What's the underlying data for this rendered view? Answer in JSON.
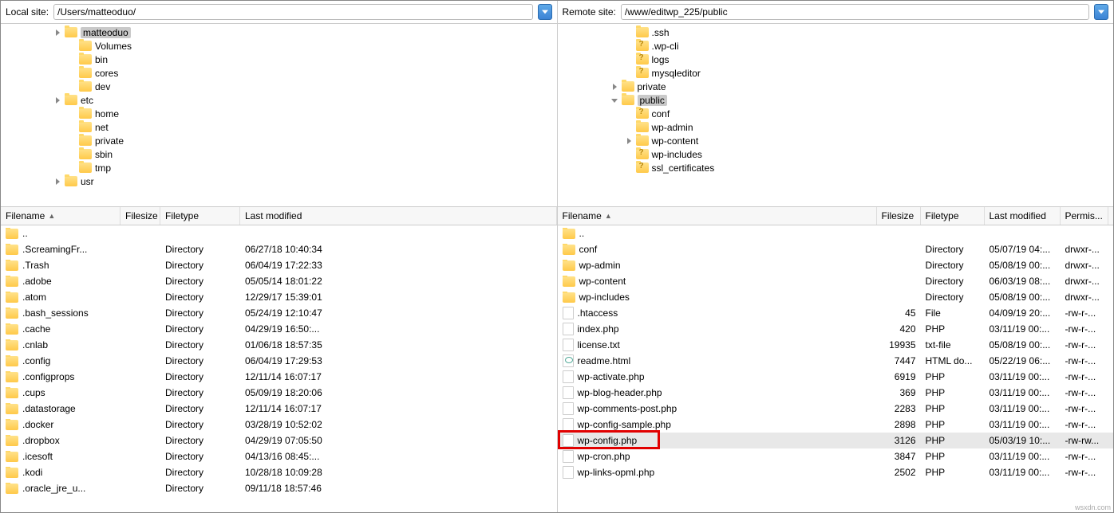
{
  "local": {
    "label": "Local site:",
    "path": "/Users/matteoduo/",
    "tree": [
      {
        "depth": 2,
        "exp": "right",
        "icon": "folder",
        "name": "matteoduo",
        "selected": true
      },
      {
        "depth": 3,
        "exp": "",
        "icon": "folder",
        "name": "Volumes"
      },
      {
        "depth": 3,
        "exp": "",
        "icon": "folder",
        "name": "bin"
      },
      {
        "depth": 3,
        "exp": "",
        "icon": "folder",
        "name": "cores"
      },
      {
        "depth": 3,
        "exp": "",
        "icon": "folder",
        "name": "dev"
      },
      {
        "depth": 2,
        "exp": "right",
        "icon": "folder",
        "name": "etc"
      },
      {
        "depth": 3,
        "exp": "",
        "icon": "folder",
        "name": "home"
      },
      {
        "depth": 3,
        "exp": "",
        "icon": "folder",
        "name": "net"
      },
      {
        "depth": 3,
        "exp": "",
        "icon": "folder",
        "name": "private"
      },
      {
        "depth": 3,
        "exp": "",
        "icon": "folder",
        "name": "sbin"
      },
      {
        "depth": 3,
        "exp": "",
        "icon": "folder",
        "name": "tmp"
      },
      {
        "depth": 2,
        "exp": "right",
        "icon": "folder",
        "name": "usr"
      }
    ],
    "cols": [
      "Filename",
      "Filesize",
      "Filetype",
      "Last modified"
    ],
    "files": [
      {
        "icon": "folder",
        "name": "..",
        "size": "",
        "type": "",
        "mod": ""
      },
      {
        "icon": "folder",
        "name": ".ScreamingFr...",
        "size": "",
        "type": "Directory",
        "mod": "06/27/18 10:40:34"
      },
      {
        "icon": "folder",
        "name": ".Trash",
        "size": "",
        "type": "Directory",
        "mod": "06/04/19 17:22:33"
      },
      {
        "icon": "folder",
        "name": ".adobe",
        "size": "",
        "type": "Directory",
        "mod": "05/05/14 18:01:22"
      },
      {
        "icon": "folder",
        "name": ".atom",
        "size": "",
        "type": "Directory",
        "mod": "12/29/17 15:39:01"
      },
      {
        "icon": "folder",
        "name": ".bash_sessions",
        "size": "",
        "type": "Directory",
        "mod": "05/24/19 12:10:47"
      },
      {
        "icon": "folder",
        "name": ".cache",
        "size": "",
        "type": "Directory",
        "mod": "04/29/19 16:50:..."
      },
      {
        "icon": "folder",
        "name": ".cnlab",
        "size": "",
        "type": "Directory",
        "mod": "01/06/18 18:57:35"
      },
      {
        "icon": "folder",
        "name": ".config",
        "size": "",
        "type": "Directory",
        "mod": "06/04/19 17:29:53"
      },
      {
        "icon": "folder",
        "name": ".configprops",
        "size": "",
        "type": "Directory",
        "mod": "12/11/14 16:07:17"
      },
      {
        "icon": "folder",
        "name": ".cups",
        "size": "",
        "type": "Directory",
        "mod": "05/09/19 18:20:06"
      },
      {
        "icon": "folder",
        "name": ".datastorage",
        "size": "",
        "type": "Directory",
        "mod": "12/11/14 16:07:17"
      },
      {
        "icon": "folder",
        "name": ".docker",
        "size": "",
        "type": "Directory",
        "mod": "03/28/19 10:52:02"
      },
      {
        "icon": "folder",
        "name": ".dropbox",
        "size": "",
        "type": "Directory",
        "mod": "04/29/19 07:05:50"
      },
      {
        "icon": "folder",
        "name": ".icesoft",
        "size": "",
        "type": "Directory",
        "mod": "04/13/16 08:45:..."
      },
      {
        "icon": "folder",
        "name": ".kodi",
        "size": "",
        "type": "Directory",
        "mod": "10/28/18 10:09:28"
      },
      {
        "icon": "folder",
        "name": ".oracle_jre_u...",
        "size": "",
        "type": "Directory",
        "mod": "09/11/18 18:57:46"
      }
    ]
  },
  "remote": {
    "label": "Remote site:",
    "path": "/www/editwp_225/public",
    "tree": [
      {
        "depth": 3,
        "exp": "",
        "icon": "folder",
        "name": ".ssh"
      },
      {
        "depth": 3,
        "exp": "",
        "icon": "question",
        "name": ".wp-cli"
      },
      {
        "depth": 3,
        "exp": "",
        "icon": "question",
        "name": "logs"
      },
      {
        "depth": 3,
        "exp": "",
        "icon": "question",
        "name": "mysqleditor"
      },
      {
        "depth": 2,
        "exp": "right",
        "icon": "folder",
        "name": "private"
      },
      {
        "depth": 2,
        "exp": "down",
        "icon": "folder",
        "name": "public",
        "selected": true
      },
      {
        "depth": 3,
        "exp": "",
        "icon": "question",
        "name": "conf"
      },
      {
        "depth": 3,
        "exp": "",
        "icon": "folder",
        "name": "wp-admin"
      },
      {
        "depth": 2,
        "exp": "right",
        "icon": "folder",
        "name": "wp-content",
        "extraIndent": 1
      },
      {
        "depth": 3,
        "exp": "",
        "icon": "question",
        "name": "wp-includes"
      },
      {
        "depth": 3,
        "exp": "",
        "icon": "question",
        "name": "ssl_certificates"
      }
    ],
    "cols": [
      "Filename",
      "Filesize",
      "Filetype",
      "Last modified",
      "Permis..."
    ],
    "files": [
      {
        "icon": "folder",
        "name": "..",
        "size": "",
        "type": "",
        "mod": "",
        "perm": ""
      },
      {
        "icon": "folder",
        "name": "conf",
        "size": "",
        "type": "Directory",
        "mod": "05/07/19 04:...",
        "perm": "drwxr-..."
      },
      {
        "icon": "folder",
        "name": "wp-admin",
        "size": "",
        "type": "Directory",
        "mod": "05/08/19 00:...",
        "perm": "drwxr-..."
      },
      {
        "icon": "folder",
        "name": "wp-content",
        "size": "",
        "type": "Directory",
        "mod": "06/03/19 08:...",
        "perm": "drwxr-..."
      },
      {
        "icon": "folder",
        "name": "wp-includes",
        "size": "",
        "type": "Directory",
        "mod": "05/08/19 00:...",
        "perm": "drwxr-..."
      },
      {
        "icon": "file",
        "name": ".htaccess",
        "size": "45",
        "type": "File",
        "mod": "04/09/19 20:...",
        "perm": "-rw-r-..."
      },
      {
        "icon": "file",
        "name": "index.php",
        "size": "420",
        "type": "PHP",
        "mod": "03/11/19 00:...",
        "perm": "-rw-r-..."
      },
      {
        "icon": "file",
        "name": "license.txt",
        "size": "19935",
        "type": "txt-file",
        "mod": "05/08/19 00:...",
        "perm": "-rw-r-..."
      },
      {
        "icon": "html",
        "name": "readme.html",
        "size": "7447",
        "type": "HTML do...",
        "mod": "05/22/19 06:...",
        "perm": "-rw-r-..."
      },
      {
        "icon": "file",
        "name": "wp-activate.php",
        "size": "6919",
        "type": "PHP",
        "mod": "03/11/19 00:...",
        "perm": "-rw-r-..."
      },
      {
        "icon": "file",
        "name": "wp-blog-header.php",
        "size": "369",
        "type": "PHP",
        "mod": "03/11/19 00:...",
        "perm": "-rw-r-..."
      },
      {
        "icon": "file",
        "name": "wp-comments-post.php",
        "size": "2283",
        "type": "PHP",
        "mod": "03/11/19 00:...",
        "perm": "-rw-r-..."
      },
      {
        "icon": "file",
        "name": "wp-config-sample.php",
        "size": "2898",
        "type": "PHP",
        "mod": "03/11/19 00:...",
        "perm": "-rw-r-..."
      },
      {
        "icon": "file",
        "name": "wp-config.php",
        "size": "3126",
        "type": "PHP",
        "mod": "05/03/19 10:...",
        "perm": "-rw-rw...",
        "highlight": true,
        "redbox": true
      },
      {
        "icon": "file",
        "name": "wp-cron.php",
        "size": "3847",
        "type": "PHP",
        "mod": "03/11/19 00:...",
        "perm": "-rw-r-..."
      },
      {
        "icon": "file",
        "name": "wp-links-opml.php",
        "size": "2502",
        "type": "PHP",
        "mod": "03/11/19 00:...",
        "perm": "-rw-r-..."
      }
    ]
  },
  "watermark": "wsxdn.com"
}
